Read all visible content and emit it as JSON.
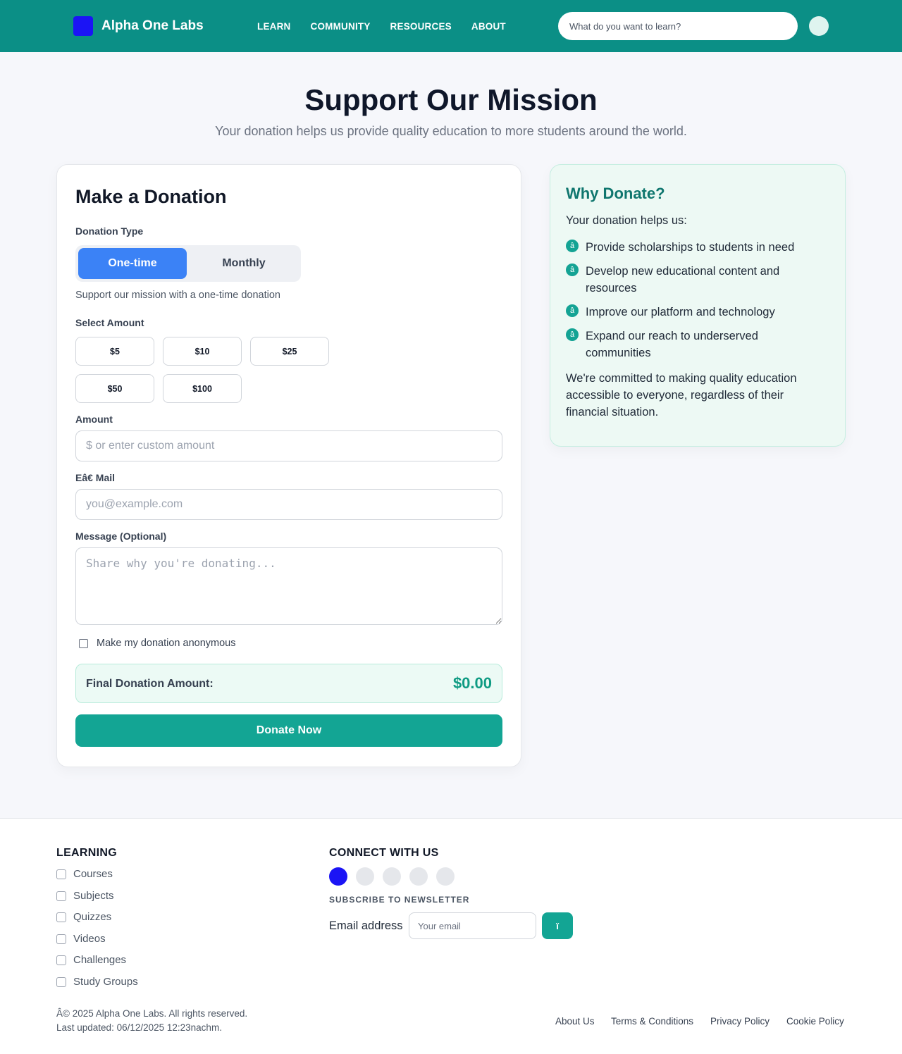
{
  "header": {
    "brand": "Alpha One Labs",
    "nav": [
      "LEARN",
      "COMMUNITY",
      "RESOURCES",
      "ABOUT"
    ],
    "search_placeholder": "What do you want to learn?"
  },
  "hero": {
    "title": "Support Our Mission",
    "subtitle": "Your donation helps us provide quality education to more students around the world."
  },
  "donation": {
    "heading": "Make a Donation",
    "type_label": "Donation Type",
    "type_options": [
      "One-time",
      "Monthly"
    ],
    "type_hint": "Support our mission with a one-time donation",
    "select_amount_label": "Select Amount",
    "amounts": [
      "$5",
      "$10",
      "$25",
      "$50",
      "$100"
    ],
    "amount_label": "Amount",
    "amount_placeholder": "$ or enter custom amount",
    "email_label": "Eâ€ Mail",
    "email_placeholder": "you@example.com",
    "message_label": "Message (Optional)",
    "message_placeholder": "Share why you're donating...",
    "anonymous_label": "Make my donation anonymous",
    "final_label": "Final Donation Amount:",
    "final_value": "$0.00",
    "submit_label": "Donate Now"
  },
  "why": {
    "title": "Why Donate?",
    "intro": "Your donation helps us:",
    "bullet_glyph": "â",
    "items": [
      "Provide scholarships to students in need",
      "Develop new educational content and resources",
      "Improve our platform and technology",
      "Expand our reach to underserved communities"
    ],
    "outro": "We're committed to making quality education accessible to everyone, regardless of their financial situation."
  },
  "footer": {
    "learning_heading": "LEARNING",
    "learning_links": [
      "Courses",
      "Subjects",
      "Quizzes",
      "Videos",
      "Challenges",
      "Study Groups"
    ],
    "connect_heading": "CONNECT WITH US",
    "newsletter_heading": "SUBSCRIBE TO NEWSLETTER",
    "email_label": "Email address",
    "email_placeholder": "Your email",
    "email_button": "ï",
    "copyright": "Â© 2025 Alpha One Labs. All rights reserved.",
    "updated": "Last updated: 06/12/2025 12:23nachm.",
    "legal_links": [
      "About Us",
      "Terms & Conditions",
      "Privacy Policy",
      "Cookie Policy"
    ]
  },
  "colors": {
    "header_bg": "#0b8f86",
    "accent": "#13a594",
    "toggle_active": "#3b82f6",
    "brand_logo": "#1b14f5"
  }
}
